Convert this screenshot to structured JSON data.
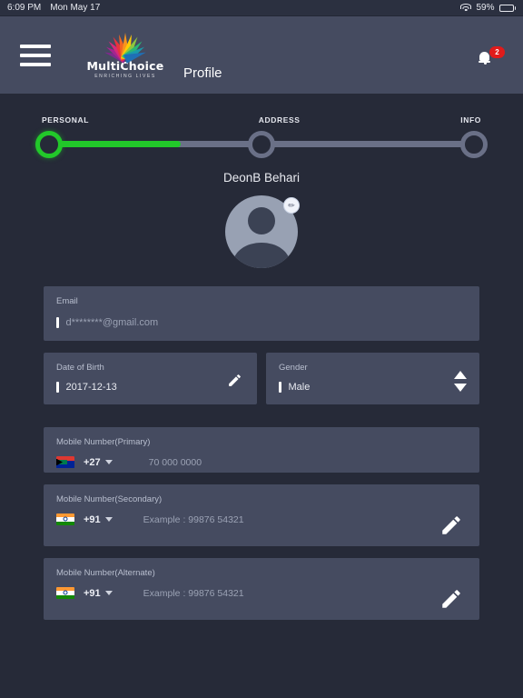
{
  "statusbar": {
    "time": "6:09 PM",
    "date": "Mon May 17",
    "battery_percent": "59%",
    "wifi_icon": "wifi-icon",
    "battery_icon": "battery-icon"
  },
  "header": {
    "menu_icon": "hamburger-icon",
    "logo_text": "MultiChoice",
    "logo_tagline": "ENRICHING LIVES",
    "title": "Profile",
    "bell_icon": "bell-icon",
    "notification_count": "2",
    "bar_color": "#454b60",
    "badge_color": "#e01b1b"
  },
  "stepper": {
    "steps": [
      {
        "label": "PERSONAL",
        "state": "active"
      },
      {
        "label": "ADDRESS",
        "state": "inactive"
      },
      {
        "label": "INFO",
        "state": "inactive"
      }
    ],
    "progress_percent": 31,
    "active_color": "#22c82a",
    "track_color": "#6a7087"
  },
  "profile": {
    "name": "DeonB Behari",
    "avatar_icon": "avatar-placeholder",
    "edit_badge_icon": "edit-attachment-icon"
  },
  "form": {
    "email": {
      "label": "Email",
      "value": "d********@gmail.com"
    },
    "dob": {
      "label": "Date of Birth",
      "value": "2017-12-13",
      "edit_icon": "pencil-icon"
    },
    "gender": {
      "label": "Gender",
      "value": "Male",
      "up_icon": "arrow-up-icon",
      "down_icon": "arrow-down-icon"
    },
    "mobile_primary": {
      "label": "Mobile Number(Primary)",
      "flag": "flag-south-africa",
      "dial_code": "+27",
      "placeholder": "70 000 0000"
    },
    "mobile_secondary": {
      "label": "Mobile Number(Secondary)",
      "flag": "flag-india",
      "dial_code": "+91",
      "placeholder": "Example :  99876 54321",
      "edit_icon": "pencil-icon"
    },
    "mobile_alternate": {
      "label": "Mobile Number(Alternate)",
      "flag": "flag-india",
      "dial_code": "+91",
      "placeholder": "Example :  99876 54321",
      "edit_icon": "pencil-icon"
    }
  }
}
